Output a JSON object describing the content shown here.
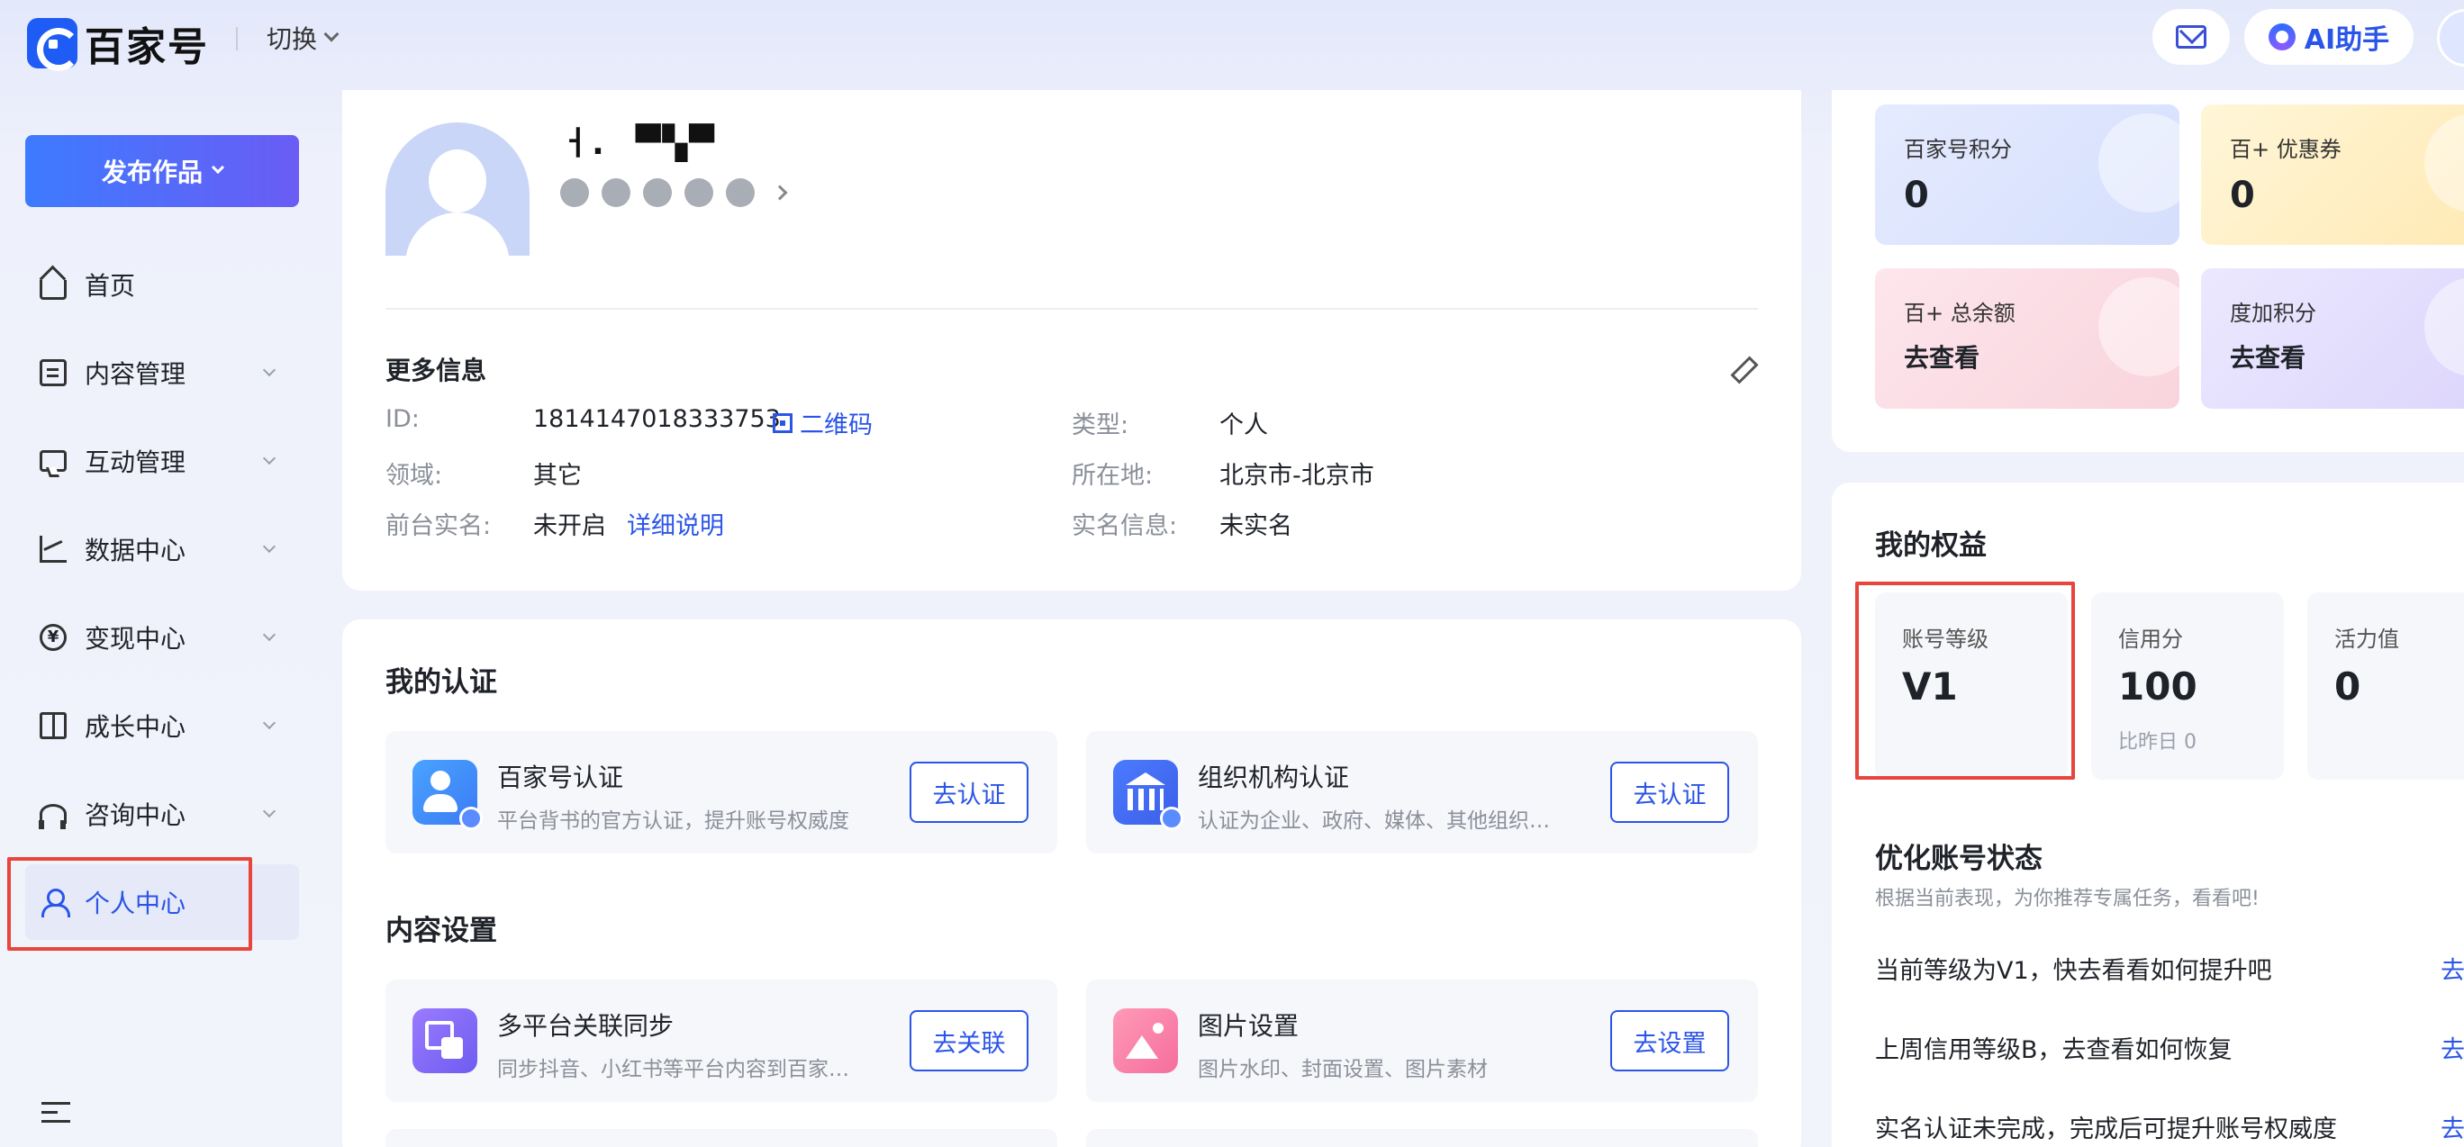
{
  "header": {
    "logo_text": "百家号",
    "switch_label": "切换",
    "ai_label": "AI助手",
    "icons": [
      "mail-icon",
      "ai-assistant-icon",
      "user-avatar"
    ]
  },
  "sidebar": {
    "publish_label": "发布作品",
    "items": [
      {
        "label": "首页",
        "icon": "home-icon",
        "expandable": false
      },
      {
        "label": "内容管理",
        "icon": "document-icon",
        "expandable": true
      },
      {
        "label": "互动管理",
        "icon": "chat-icon",
        "expandable": true
      },
      {
        "label": "数据中心",
        "icon": "chart-icon",
        "expandable": true
      },
      {
        "label": "变现中心",
        "icon": "yen-icon",
        "expandable": true
      },
      {
        "label": "成长中心",
        "icon": "book-icon",
        "expandable": true
      },
      {
        "label": "咨询中心",
        "icon": "headset-icon",
        "expandable": true
      },
      {
        "label": "个人中心",
        "icon": "user-icon",
        "expandable": false,
        "active": true
      }
    ]
  },
  "profile": {
    "username": "ㅓ.ᅟ▀▚▀",
    "more_info_title": "更多信息",
    "fields": {
      "id_label": "ID:",
      "id_value": "1814147018333753",
      "qr_label": "二维码",
      "type_label": "类型:",
      "type_value": "个人",
      "domain_label": "领域:",
      "domain_value": "其它",
      "location_label": "所在地:",
      "location_value": "北京市-北京市",
      "realname_front_label": "前台实名:",
      "realname_front_value": "未开启",
      "realname_front_link": "详细说明",
      "realname_info_label": "实名信息:",
      "realname_info_value": "未实名"
    }
  },
  "certification": {
    "title": "我的认证",
    "items": [
      {
        "title": "百家号认证",
        "desc": "平台背书的官方认证，提升账号权威度",
        "button": "去认证",
        "icon": "person-cert-icon"
      },
      {
        "title": "组织机构认证",
        "desc": "认证为企业、政府、媒体、其他组织…",
        "button": "去认证",
        "icon": "org-cert-icon"
      }
    ]
  },
  "content_settings": {
    "title": "内容设置",
    "items": [
      {
        "title": "多平台关联同步",
        "desc": "同步抖音、小红书等平台内容到百家…",
        "button": "去关联",
        "icon": "sync-icon"
      },
      {
        "title": "图片设置",
        "desc": "图片水印、封面设置、图片素材",
        "button": "去设置",
        "icon": "image-icon"
      }
    ]
  },
  "assets": {
    "tiles": [
      {
        "label": "百家号积分",
        "value": "0"
      },
      {
        "label": "百+ 优惠券",
        "value": "0"
      },
      {
        "label": "百+ 总余额",
        "value": "去查看"
      },
      {
        "label": "度加积分",
        "value": "去查看"
      }
    ]
  },
  "rights": {
    "title": "我的权益",
    "stats": [
      {
        "label": "账号等级",
        "value": "V1",
        "sub": ""
      },
      {
        "label": "信用分",
        "value": "100",
        "sub": "比昨日 0"
      },
      {
        "label": "活力值",
        "value": "0",
        "sub": ""
      }
    ],
    "optimize_title": "优化账号状态",
    "optimize_sub": "根据当前表现，为你推荐专属任务，看看吧!",
    "tasks": [
      {
        "text": "当前等级为V1，快去看看如何提升吧",
        "action": "去"
      },
      {
        "text": "上周信用等级B，去查看如何恢复",
        "action": "去"
      },
      {
        "text": "实名认证未完成，完成后可提升账号权威度",
        "action": "去"
      }
    ]
  },
  "colors": {
    "accent": "#2b55e8",
    "highlight_box": "#e8453c"
  }
}
